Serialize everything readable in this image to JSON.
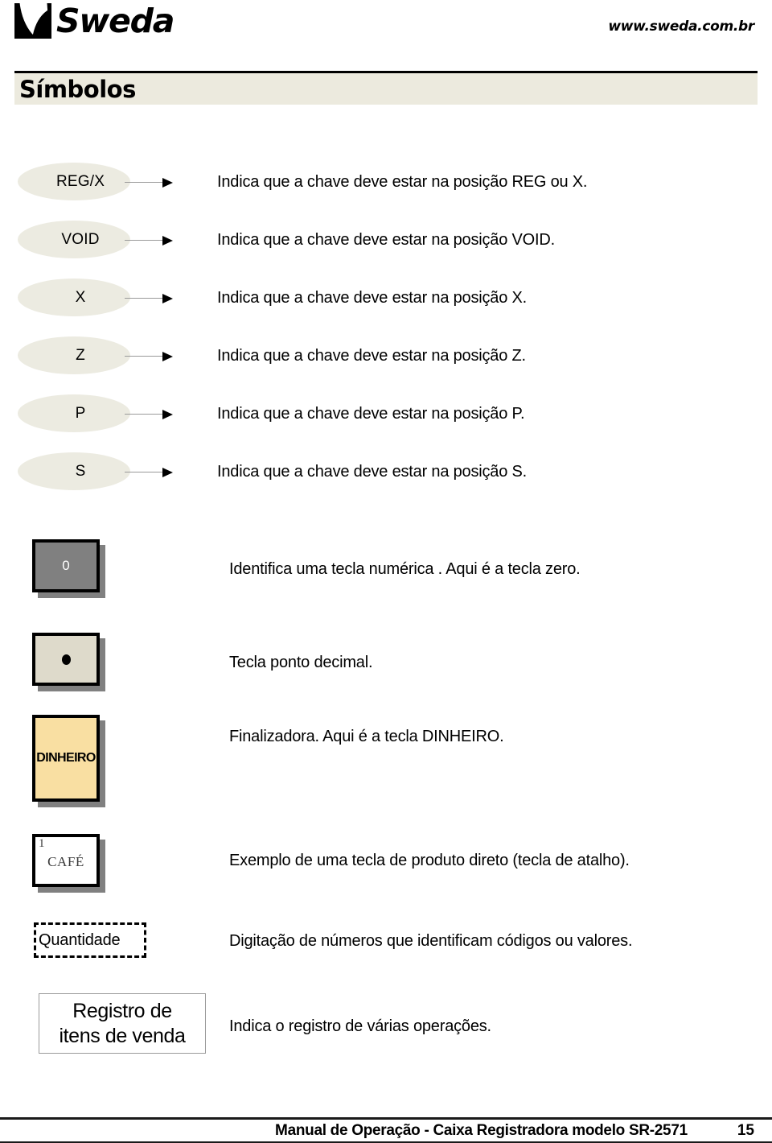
{
  "header": {
    "logo_icon": "sweda-logo-icon",
    "logo_text": "Sweda",
    "url": "www.sweda.com.br"
  },
  "section": {
    "title": "Símbolos"
  },
  "key_position_symbols": [
    {
      "badge": "REG/X",
      "description": "Indica que a chave deve estar na posição REG ou X."
    },
    {
      "badge": "VOID",
      "description": "Indica que a chave deve estar na posição VOID."
    },
    {
      "badge": "X",
      "description": "Indica que a chave deve estar na posição X."
    },
    {
      "badge": "Z",
      "description": "Indica que a chave deve estar na posição Z."
    },
    {
      "badge": "P",
      "description": "Indica que a chave deve estar na posição P."
    },
    {
      "badge": "S",
      "description": "Indica que a chave deve estar na posição S."
    }
  ],
  "key_symbols": {
    "numeric": {
      "label": "0",
      "description": "Identifica uma tecla numérica . Aqui é a tecla zero.",
      "fill_color": "#808080",
      "text_color": "#ffffff"
    },
    "decimal": {
      "glyph_icon": "decimal-dot-icon",
      "description": "Tecla ponto decimal.",
      "fill_color": "#dedacb"
    },
    "finalizer": {
      "label": "DINHEIRO",
      "description": "Finalizadora. Aqui é a tecla DINHEIRO.",
      "fill_color": "#f9dfa2"
    },
    "product": {
      "corner_number": "1",
      "label": "CAFÉ",
      "description": "Exemplo de uma tecla de produto direto (tecla de atalho).",
      "fill_color": "#ffffff"
    },
    "quantity": {
      "label": "Quantidade",
      "description": "Digitação de números que identificam códigos ou valores."
    },
    "operations": {
      "line1": "Registro de",
      "line2": "itens de venda",
      "description": "Indica o registro de várias operações."
    }
  },
  "footer": {
    "title": "Manual de Operação - Caixa Registradora modelo SR-2571",
    "page_number": "15"
  },
  "colors": {
    "band_bg": "#eceade",
    "ellipse_fill": "#ecebe1",
    "shadow": "#808080"
  }
}
